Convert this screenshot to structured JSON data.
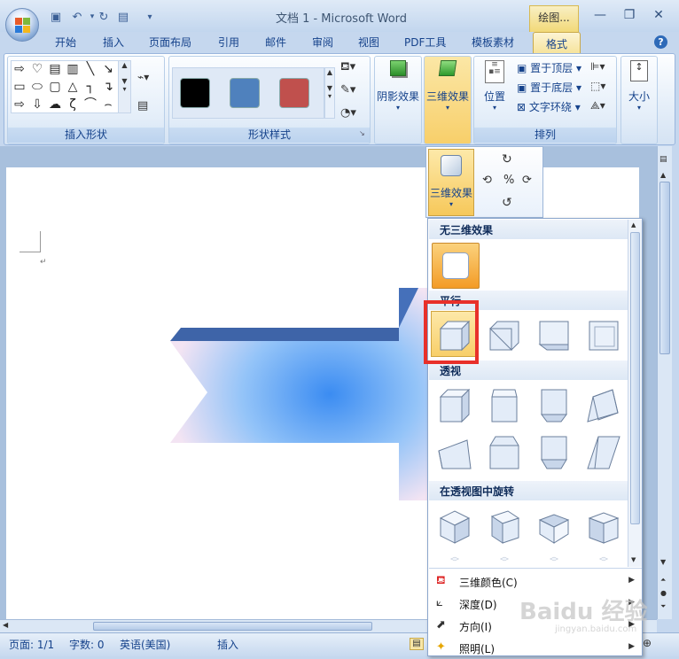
{
  "window": {
    "title": "文档 1 - Microsoft Word",
    "context_tab": "绘图..."
  },
  "tabs": [
    "开始",
    "插入",
    "页面布局",
    "引用",
    "邮件",
    "审阅",
    "视图",
    "PDF工具",
    "模板素材",
    "格式"
  ],
  "ribbon": {
    "groups": {
      "insert_shapes": "插入形状",
      "shape_styles": "形状样式",
      "arrange": "排列"
    },
    "shadow_effects": "阴影效果",
    "three_d_effects": "三维效果",
    "position": "位置",
    "bring_front": "置于顶层",
    "send_back": "置于底层",
    "text_wrap": "文字环绕",
    "size": "大小",
    "swatch_colors": [
      "#000000",
      "#4f81bd",
      "#c0504d"
    ]
  },
  "flyout": {
    "three_d_effects": "三维效果"
  },
  "gallery": {
    "no_3d": "无三维效果",
    "parallel": "平行",
    "perspective": "透视",
    "rotate_perspective": "在透视图中旋转",
    "menu": [
      {
        "label": "三维颜色(C)",
        "icon": "paint-bucket-icon"
      },
      {
        "label": "深度(D)",
        "icon": "depth-icon"
      },
      {
        "label": "方向(I)",
        "icon": "direction-icon"
      },
      {
        "label": "照明(L)",
        "icon": "lighting-icon"
      }
    ]
  },
  "status": {
    "page": "页面: 1/1",
    "words": "字数: 0",
    "lang": "英语(美国)",
    "mode": "插入"
  },
  "watermark": "Baidu 经验",
  "watermark_url": "jingyan.baidu.com",
  "accent": "#e8302a"
}
